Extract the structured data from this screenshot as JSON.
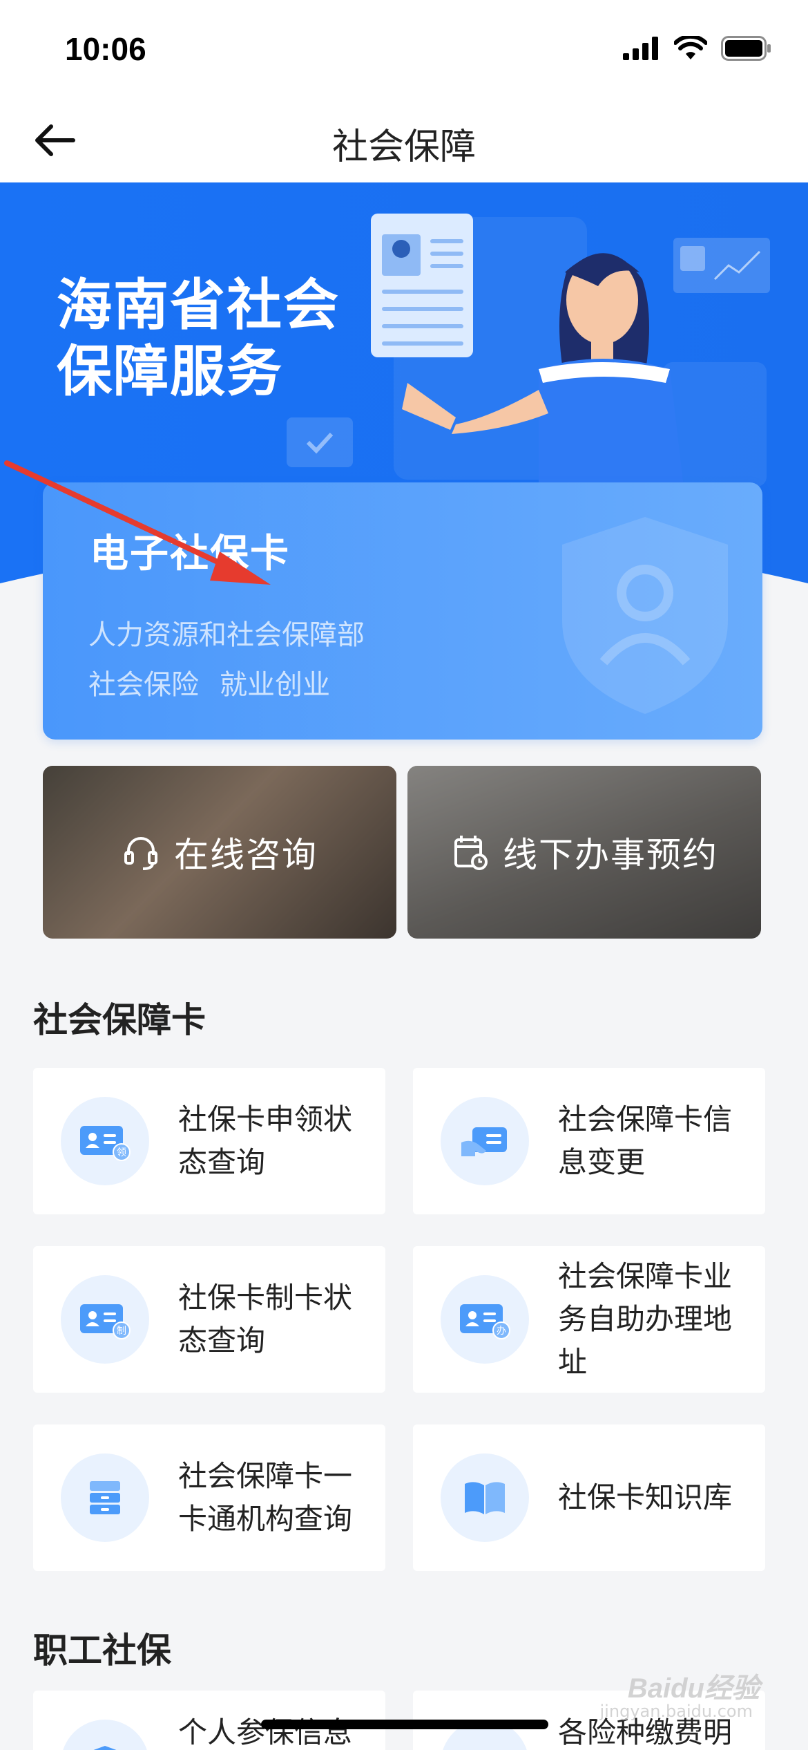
{
  "status_bar": {
    "time": "10:06"
  },
  "nav": {
    "title": "社会保障"
  },
  "hero": {
    "title_line1": "海南省社会",
    "title_line2": "保障服务"
  },
  "card": {
    "title": "电子社保卡",
    "subtitle": "人力资源和社会保障部",
    "tags": [
      "社会保险",
      "就业创业"
    ]
  },
  "quick_actions": [
    {
      "label": "在线咨询",
      "icon": "headset-icon"
    },
    {
      "label": "线下办事预约",
      "icon": "calendar-icon"
    }
  ],
  "sections": [
    {
      "title": "社会保障卡",
      "items": [
        {
          "label": "社保卡申领状态查询",
          "icon": "id-card-apply-icon",
          "badge": "领"
        },
        {
          "label": "社会保障卡信息变更",
          "icon": "card-edit-icon"
        },
        {
          "label": "社保卡制卡状态查询",
          "icon": "id-card-make-icon",
          "badge": "制"
        },
        {
          "label": "社会保障卡业务自助办理地址",
          "icon": "id-card-handle-icon",
          "badge": "办"
        },
        {
          "label": "社会保障卡一卡通机构查询",
          "icon": "cabinet-icon"
        },
        {
          "label": "社保卡知识库",
          "icon": "book-icon"
        }
      ]
    },
    {
      "title": "职工社保",
      "items": [
        {
          "label": "个人参保信息",
          "icon": "shield-user-icon"
        },
        {
          "label": "各险种缴费明",
          "icon": "payment-icon"
        }
      ]
    }
  ],
  "watermark": {
    "brand": "Baidu经验",
    "sub": "jingyan.baidu.com"
  },
  "colors": {
    "primary": "#1a73f5",
    "card": "#5aa2fb",
    "tile_icon_bg": "#e9f2fe"
  }
}
